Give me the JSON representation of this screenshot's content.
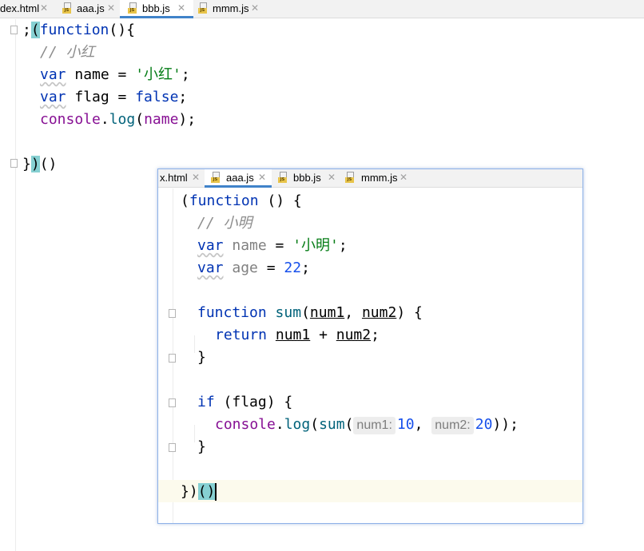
{
  "background": {
    "tabs": [
      {
        "label": "dex.html",
        "active": false,
        "icon": "html-file-icon"
      },
      {
        "label": "aaa.js",
        "active": false,
        "icon": "js-file-icon"
      },
      {
        "label": "bbb.js",
        "active": true,
        "icon": "js-file-icon"
      },
      {
        "label": "mmm.js",
        "active": false,
        "icon": "js-file-icon"
      }
    ],
    "code": {
      "l1a": ";",
      "l1b": "(",
      "l1c": "function",
      "l1d": "(){",
      "l2": "// 小红",
      "l3a": "var",
      "l3b": " name = ",
      "l3c": "'小红'",
      "l3d": ";",
      "l4a": "var",
      "l4b": " flag = ",
      "l4c": "false",
      "l4d": ";",
      "l5a": "console",
      "l5b": ".",
      "l5c": "log",
      "l5d": "(",
      "l5e": "name",
      "l5f": ");",
      "l7a": "}",
      "l7b": ")",
      "l7c": "()"
    }
  },
  "popup": {
    "tabs": [
      {
        "label": "x.html",
        "active": false
      },
      {
        "label": "aaa.js",
        "active": true
      },
      {
        "label": "bbb.js",
        "active": false
      },
      {
        "label": "mmm.js",
        "active": false
      }
    ],
    "code": {
      "l1a": "(",
      "l1b": "function",
      "l1c": " () {",
      "l2": "// 小明",
      "l3a": "var",
      "l3b": " name",
      "l3c": " = ",
      "l3d": "'小明'",
      "l3e": ";",
      "l4a": "var",
      "l4b": " age",
      "l4c": " = ",
      "l4d": "22",
      "l4e": ";",
      "l6a": "function",
      "l6b": " sum",
      "l6c": "(",
      "l6d": "num1",
      "l6e": ", ",
      "l6f": "num2",
      "l6g": ") {",
      "l7a": "return",
      "l7b": " ",
      "l7c": "num1",
      "l7d": " + ",
      "l7e": "num2",
      "l7f": ";",
      "l8": "}",
      "l10a": "if",
      "l10b": " (flag) {",
      "l11a": "console",
      "l11b": ".",
      "l11c": "log",
      "l11d": "(",
      "l11e": "sum",
      "l11f": "(",
      "hint1": "num1:",
      "v1": "10",
      "sep": ", ",
      "hint2": "num2:",
      "v2": "20",
      "l11g": "));",
      "l12": "}",
      "l14a": "})",
      "l14b": "()"
    }
  },
  "colors": {
    "keyword": "#0033b3",
    "string": "#067d17",
    "comment": "#8c8c8c",
    "number": "#1750eb",
    "member": "#871094",
    "brace_highlight": "#86d0d2",
    "tab_accent": "#4083c9"
  },
  "close_glyph": "✕",
  "js_badge": "JS"
}
